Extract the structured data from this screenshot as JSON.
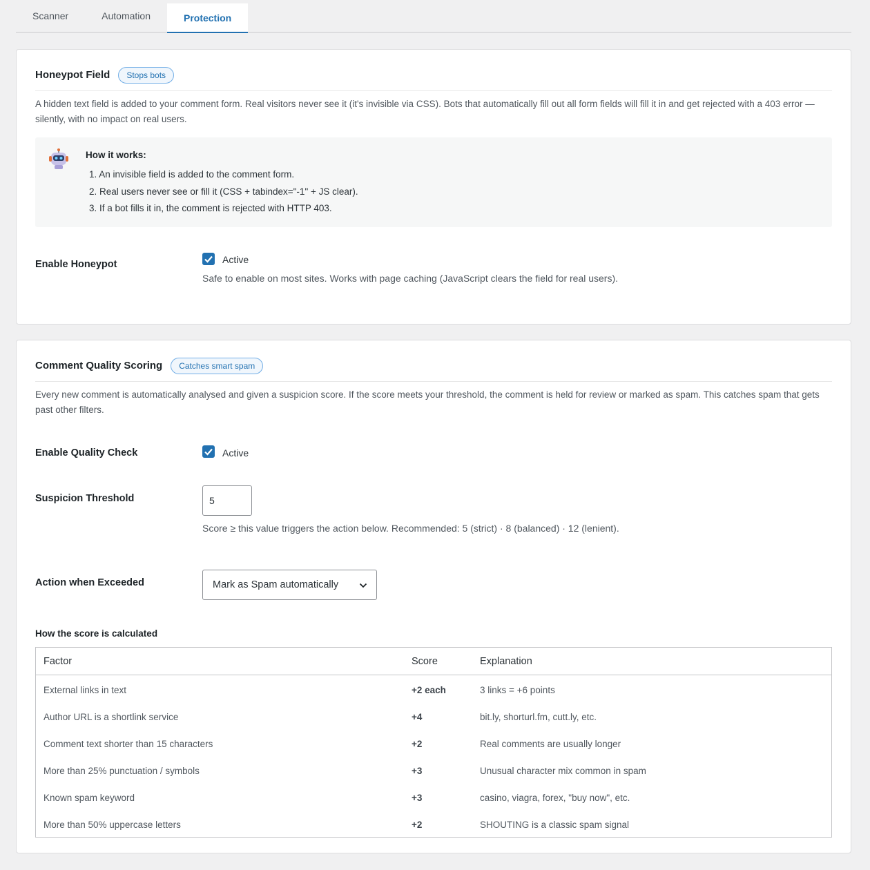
{
  "tabs": [
    {
      "label": "Scanner"
    },
    {
      "label": "Automation"
    },
    {
      "label": "Protection"
    }
  ],
  "honeypot": {
    "title": "Honeypot Field",
    "badge": "Stops bots",
    "description": "A hidden text field is added to your comment form. Real visitors never see it (it's invisible via CSS). Bots that automatically fill out all form fields will fill it in and get rejected with a 403 error — silently, with no impact on real users.",
    "how_title": "How it works:",
    "how_steps": [
      "1. An invisible field is added to the comment form.",
      "2. Real users never see or fill it (CSS + tabindex=\"-1\" + JS clear).",
      "3. If a bot fills it in, the comment is rejected with HTTP 403."
    ],
    "enable_label": "Enable Honeypot",
    "checkbox_label": "Active",
    "checked": true,
    "help": "Safe to enable on most sites. Works with page caching (JavaScript clears the field for real users)."
  },
  "quality": {
    "title": "Comment Quality Scoring",
    "badge": "Catches smart spam",
    "description": "Every new comment is automatically analysed and given a suspicion score. If the score meets your threshold, the comment is held for review or marked as spam. This catches spam that gets past other filters.",
    "enable_label": "Enable Quality Check",
    "checkbox_label": "Active",
    "checked": true,
    "threshold_label": "Suspicion Threshold",
    "threshold_value": "5",
    "threshold_help": "Score ≥ this value triggers the action below. Recommended: 5 (strict) · 8 (balanced) · 12 (lenient).",
    "action_label": "Action when Exceeded",
    "action_value": "Mark as Spam automatically",
    "table_title": "How the score is calculated",
    "table_headers": [
      "Factor",
      "Score",
      "Explanation"
    ],
    "table_rows": [
      {
        "factor": "External links in text",
        "score": "+2 each",
        "explanation": "3 links = +6 points"
      },
      {
        "factor": "Author URL is a shortlink service",
        "score": "+4",
        "explanation": "bit.ly, shorturl.fm, cutt.ly, etc."
      },
      {
        "factor": "Comment text shorter than 15 characters",
        "score": "+2",
        "explanation": "Real comments are usually longer"
      },
      {
        "factor": "More than 25% punctuation / symbols",
        "score": "+3",
        "explanation": "Unusual character mix common in spam"
      },
      {
        "factor": "Known spam keyword",
        "score": "+3",
        "explanation": "casino, viagra, forex, \"buy now\", etc."
      },
      {
        "factor": "More than 50% uppercase letters",
        "score": "+2",
        "explanation": "SHOUTING is a classic spam signal"
      }
    ]
  },
  "colors": {
    "accent": "#2271b1",
    "background": "#f0f0f1"
  }
}
